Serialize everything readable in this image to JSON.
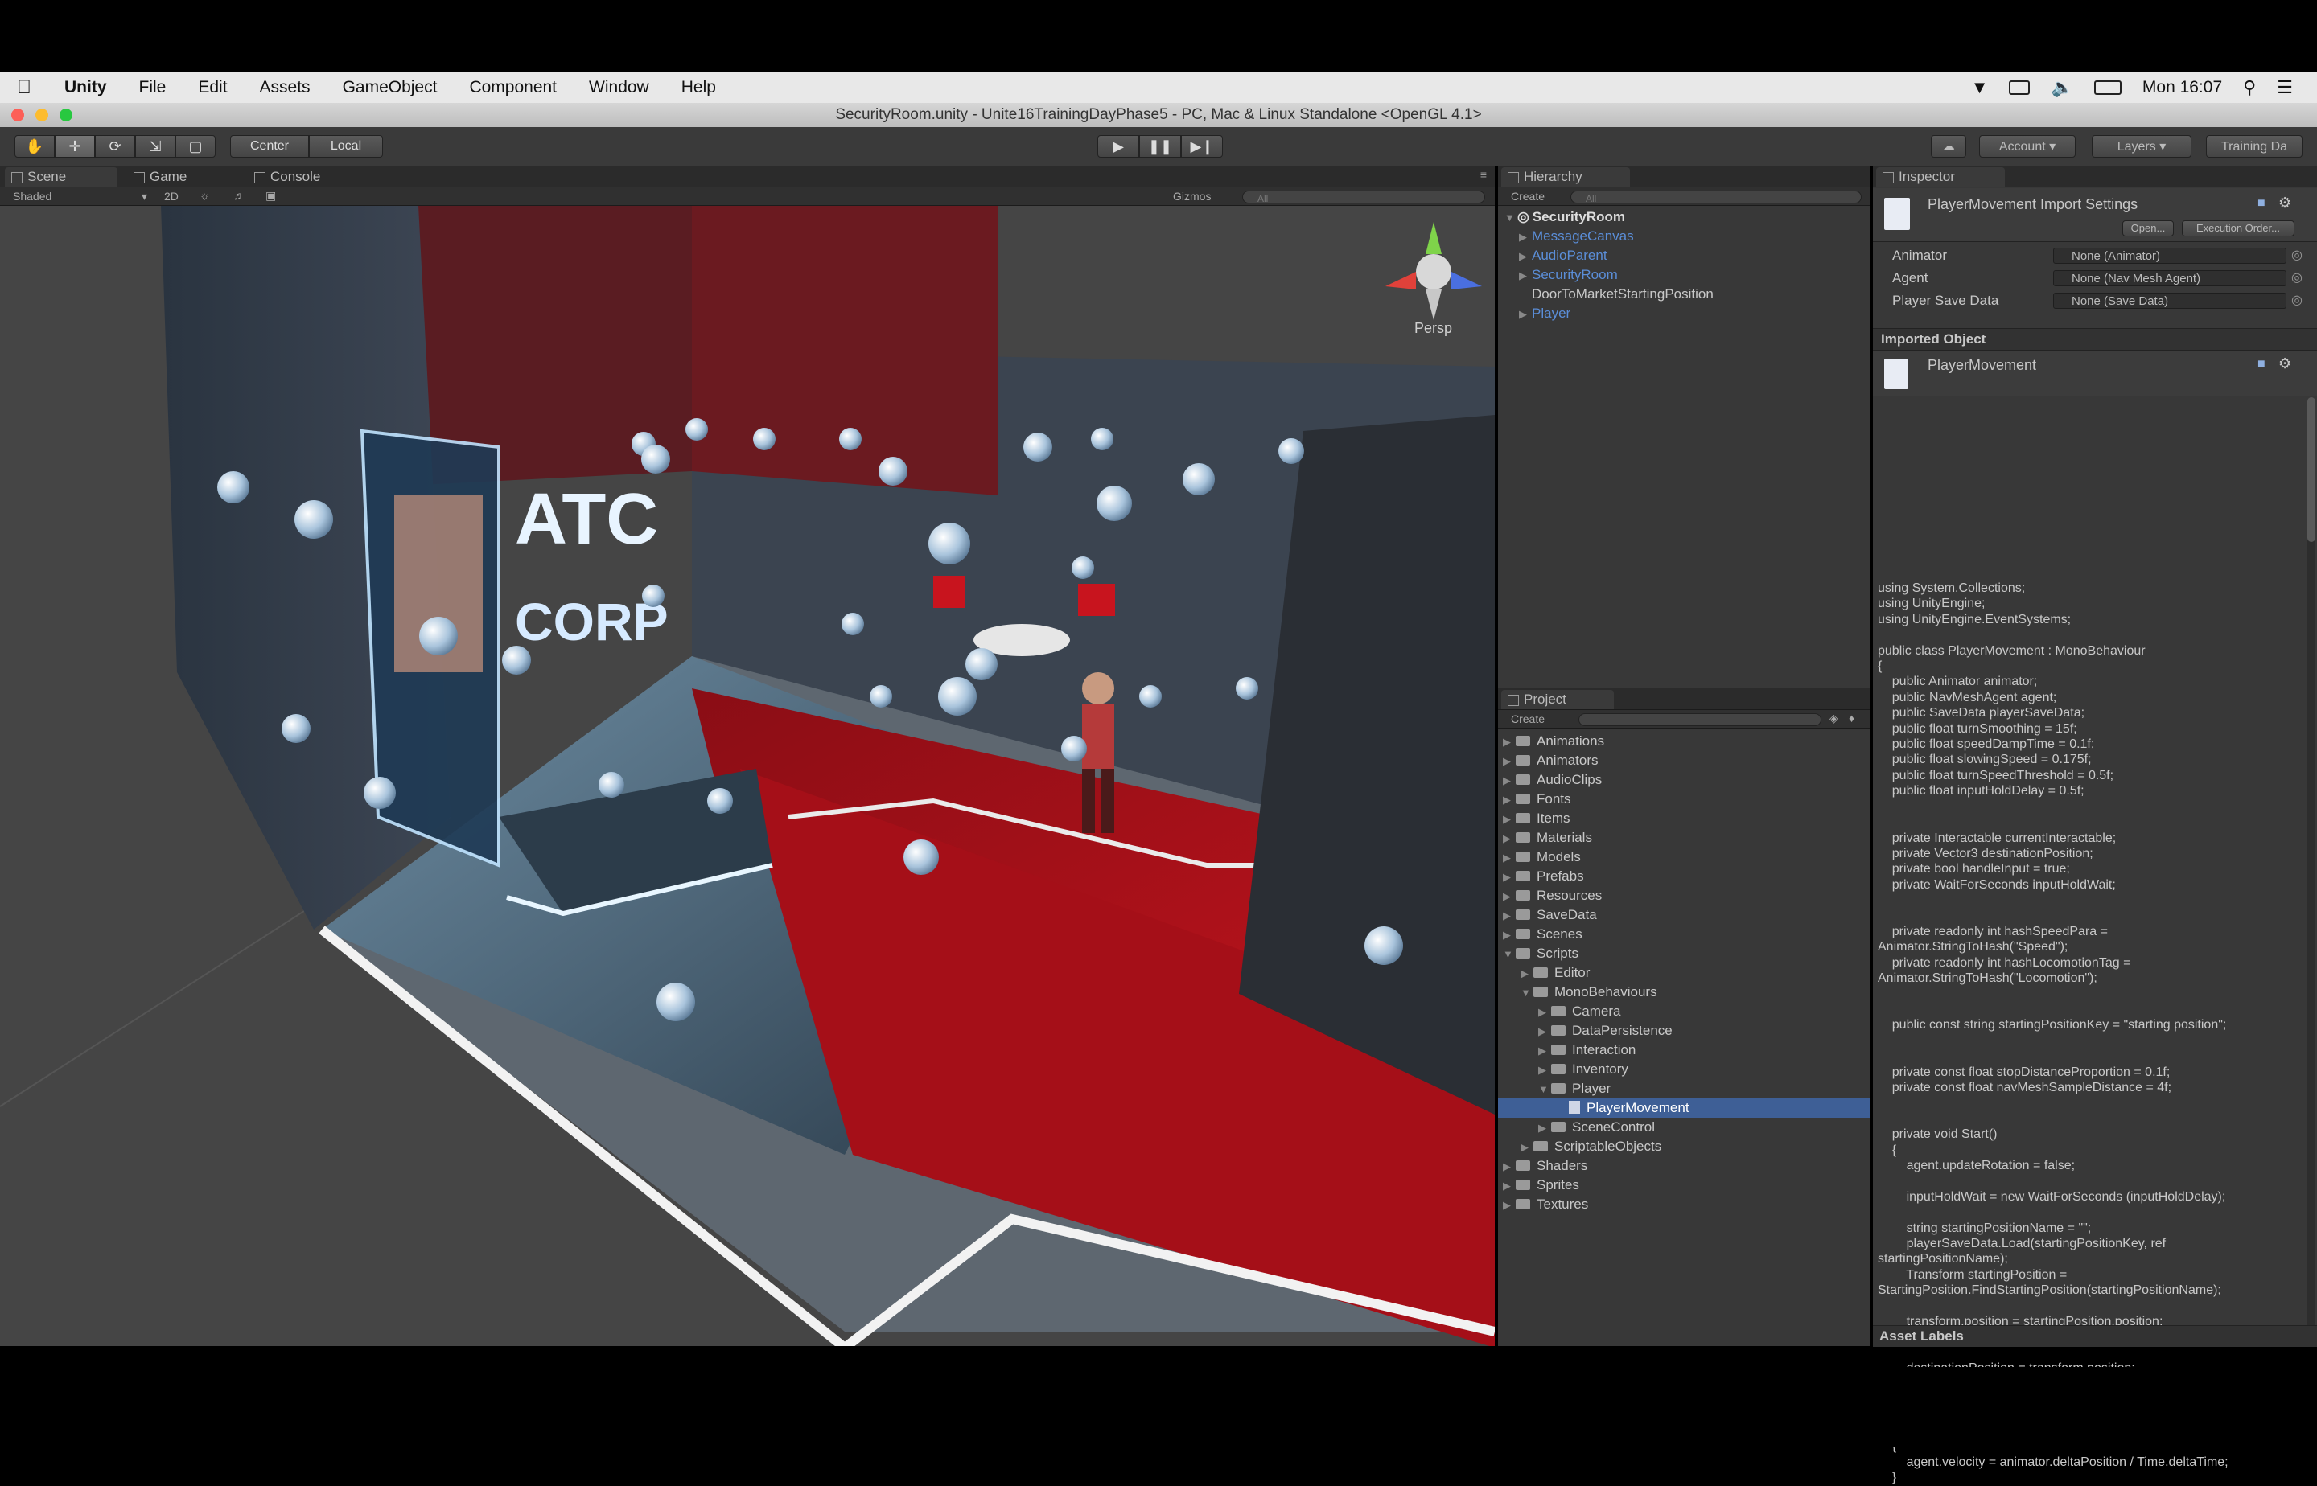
{
  "menubar": {
    "app": "Unity",
    "items": [
      "File",
      "Edit",
      "Assets",
      "GameObject",
      "Component",
      "Window",
      "Help"
    ],
    "clock": "Mon 16:07"
  },
  "window": {
    "title": "SecurityRoom.unity - Unite16TrainingDayPhase5 - PC, Mac & Linux Standalone <OpenGL 4.1>"
  },
  "toolbar": {
    "pivot": "Center",
    "space": "Local",
    "account": "Account",
    "layers": "Layers",
    "layout": "Training Da"
  },
  "scene_panel": {
    "tabs": [
      "Scene",
      "Game",
      "Console"
    ],
    "shading": "Shaded",
    "mode_2d": "2D",
    "gizmos": "Gizmos",
    "search_placeholder": "All",
    "persp": "Persp",
    "sign_top": "ATC",
    "sign_bottom": "CORP"
  },
  "hierarchy": {
    "title": "Hierarchy",
    "create": "Create",
    "search_placeholder": "All",
    "scene": "SecurityRoom",
    "items": [
      {
        "label": "MessageCanvas",
        "prefab": true,
        "arrow": true
      },
      {
        "label": "AudioParent",
        "prefab": true,
        "arrow": true
      },
      {
        "label": "SecurityRoom",
        "prefab": true,
        "arrow": true
      },
      {
        "label": "DoorToMarketStartingPosition",
        "prefab": false,
        "arrow": false
      },
      {
        "label": "Player",
        "prefab": true,
        "arrow": true
      }
    ]
  },
  "project": {
    "title": "Project",
    "create": "Create",
    "items": [
      {
        "label": "Animations",
        "depth": 0,
        "open": false
      },
      {
        "label": "Animators",
        "depth": 0,
        "open": false
      },
      {
        "label": "AudioClips",
        "depth": 0,
        "open": false
      },
      {
        "label": "Fonts",
        "depth": 0,
        "open": false
      },
      {
        "label": "Items",
        "depth": 0,
        "open": false
      },
      {
        "label": "Materials",
        "depth": 0,
        "open": false
      },
      {
        "label": "Models",
        "depth": 0,
        "open": false
      },
      {
        "label": "Prefabs",
        "depth": 0,
        "open": false
      },
      {
        "label": "Resources",
        "depth": 0,
        "open": false
      },
      {
        "label": "SaveData",
        "depth": 0,
        "open": false
      },
      {
        "label": "Scenes",
        "depth": 0,
        "open": false
      },
      {
        "label": "Scripts",
        "depth": 0,
        "open": true
      },
      {
        "label": "Editor",
        "depth": 1,
        "open": false
      },
      {
        "label": "MonoBehaviours",
        "depth": 1,
        "open": true
      },
      {
        "label": "Camera",
        "depth": 2,
        "open": false
      },
      {
        "label": "DataPersistence",
        "depth": 2,
        "open": false
      },
      {
        "label": "Interaction",
        "depth": 2,
        "open": false
      },
      {
        "label": "Inventory",
        "depth": 2,
        "open": false
      },
      {
        "label": "Player",
        "depth": 2,
        "open": true
      },
      {
        "label": "PlayerMovement",
        "depth": 3,
        "open": false,
        "file": true,
        "selected": true
      },
      {
        "label": "SceneControl",
        "depth": 2,
        "open": false
      },
      {
        "label": "ScriptableObjects",
        "depth": 1,
        "open": false
      },
      {
        "label": "Shaders",
        "depth": 0,
        "open": false
      },
      {
        "label": "Sprites",
        "depth": 0,
        "open": false
      },
      {
        "label": "Textures",
        "depth": 0,
        "open": false
      }
    ]
  },
  "inspector": {
    "title": "Inspector",
    "header": "PlayerMovement Import Settings",
    "open_btn": "Open...",
    "exec_btn": "Execution Order...",
    "fields": [
      {
        "label": "Animator",
        "value": "None (Animator)"
      },
      {
        "label": "Agent",
        "value": "None (Nav Mesh Agent)"
      },
      {
        "label": "Player Save Data",
        "value": "None (Save Data)"
      }
    ],
    "imported_object": "Imported Object",
    "object_name": "PlayerMovement",
    "asset_labels": "Asset Labels",
    "code": "using System.Collections;\nusing UnityEngine;\nusing UnityEngine.EventSystems;\n\npublic class PlayerMovement : MonoBehaviour\n{\n    public Animator animator;\n    public NavMeshAgent agent;\n    public SaveData playerSaveData;\n    public float turnSmoothing = 15f;\n    public float speedDampTime = 0.1f;\n    public float slowingSpeed = 0.175f;\n    public float turnSpeedThreshold = 0.5f;\n    public float inputHoldDelay = 0.5f;\n\n\n    private Interactable currentInteractable;\n    private Vector3 destinationPosition;\n    private bool handleInput = true;\n    private WaitForSeconds inputHoldWait;\n\n\n    private readonly int hashSpeedPara =\nAnimator.StringToHash(\"Speed\");\n    private readonly int hashLocomotionTag =\nAnimator.StringToHash(\"Locomotion\");\n\n\n    public const string startingPositionKey = \"starting position\";\n\n\n    private const float stopDistanceProportion = 0.1f;\n    private const float navMeshSampleDistance = 4f;\n\n\n    private void Start()\n    {\n        agent.updateRotation = false;\n\n        inputHoldWait = new WaitForSeconds (inputHoldDelay);\n\n        string startingPositionName = \"\";\n        playerSaveData.Load(startingPositionKey, ref\nstartingPositionName);\n        Transform startingPosition =\nStartingPosition.FindStartingPosition(startingPositionName);\n\n        transform.position = startingPosition.position;\n        transform.rotation = startingPosition.rotation;\n\n        destinationPosition = transform.position;\n    }\n\n\n    private void OnAnimatorMove()\n    {\n        agent.velocity = animator.deltaPosition / Time.deltaTime;\n    }"
  },
  "colors": {
    "panel_bg": "#383838",
    "selection": "#3e5f96",
    "prefab_blue": "#5b8ed8",
    "carpet_red": "#b5121b"
  }
}
